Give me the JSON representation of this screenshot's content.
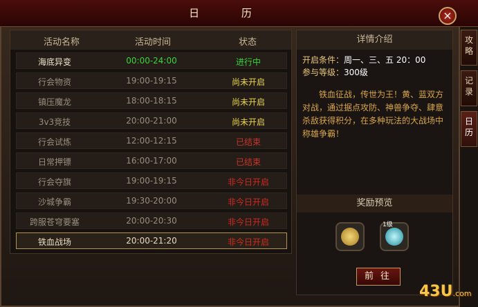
{
  "title": "日 历",
  "close": "×",
  "table": {
    "headers": [
      "活动名称",
      "活动时间",
      "状态"
    ],
    "rows": [
      {
        "name": "海底异变",
        "time": "00:00-24:00",
        "state": "进行中",
        "color": "#39d63a"
      },
      {
        "name": "行会物资",
        "time": "19:00-19:15",
        "state": "尚未开启",
        "color": "#e9d54a"
      },
      {
        "name": "镇压魔龙",
        "time": "18:00-18:15",
        "state": "尚未开启",
        "color": "#e9d54a"
      },
      {
        "name": "3v3竞技",
        "time": "20:00-21:00",
        "state": "尚未开启",
        "color": "#e9d54a"
      },
      {
        "name": "行会试炼",
        "time": "12:00-12:15",
        "state": "已结束",
        "color": "#c9352a"
      },
      {
        "name": "日常押镖",
        "time": "16:00-17:00",
        "state": "已结束",
        "color": "#c9352a"
      },
      {
        "name": "行会夺旗",
        "time": "19:00-19:15",
        "state": "非今日开启",
        "color": "#d02a20"
      },
      {
        "name": "沙城争霸",
        "time": "19:30-20:00",
        "state": "非今日开启",
        "color": "#d02a20"
      },
      {
        "name": "跨服苍穹要塞",
        "time": "20:00-20:30",
        "state": "非今日开启",
        "color": "#d02a20"
      },
      {
        "name": "铁血战场",
        "time": "20:00-21:20",
        "state": "非今日开启",
        "color": "#d02a20"
      }
    ]
  },
  "detail": {
    "header": "详情介绍",
    "open_label": "开启条件：",
    "open_value": "周一、三、五 20：00",
    "level_label": "参与等级：",
    "level_value": "300级",
    "description": "铁血征战，传世为王！黄、蓝双方对战，通过据点攻防、神兽争夺、肆意杀敌获得积分，在多种玩法的大战场中称雄争霸！"
  },
  "reward": {
    "header": "奖励预览",
    "level_badge": "1级",
    "items": [
      "gold-coins-icon",
      "gem-orb-icon"
    ]
  },
  "go_button": "前往",
  "side_tabs": [
    {
      "label": "攻略"
    },
    {
      "label": "记录"
    },
    {
      "label": "日历"
    }
  ],
  "watermark": "43U",
  "watermark_suffix": ".com"
}
